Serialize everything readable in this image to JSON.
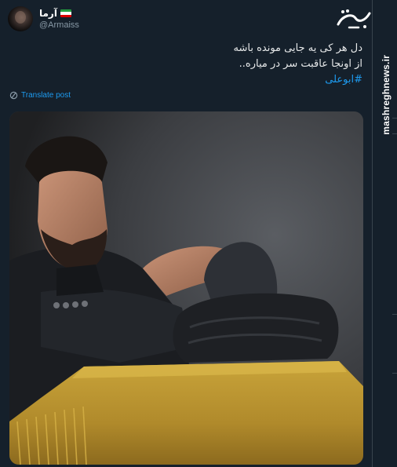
{
  "tweet": {
    "display_name": "آرما",
    "handle": "@Armaiss",
    "text_lines": [
      "دل هر کی یه جایی مونده باشه",
      "از اونجا عاقبت سر در میاره.."
    ],
    "hashtag": "#ابوعلی",
    "translate_label": "Translate post"
  },
  "watermark": {
    "text": "mashreghnews.ir"
  },
  "colors": {
    "background": "#15202b",
    "accent": "#1d9bf0",
    "secondary_text": "#8899a6",
    "divider": "#38444d"
  },
  "icons": [
    "iran-flag-icon",
    "translate-icon",
    "mashregh-logo"
  ]
}
